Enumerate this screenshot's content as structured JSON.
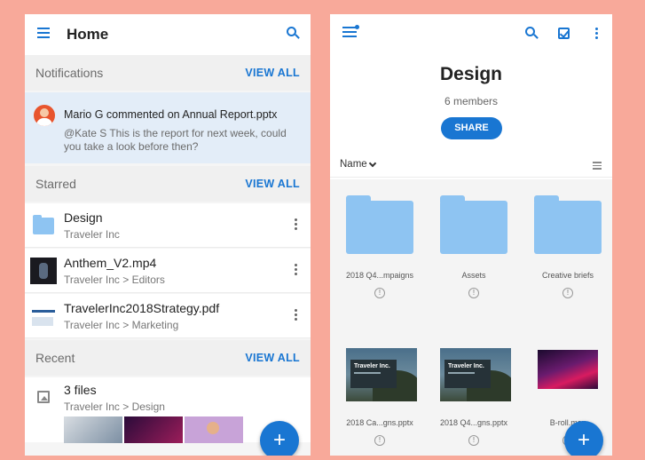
{
  "left": {
    "header": {
      "title": "Home"
    },
    "notifications": {
      "label": "Notifications",
      "view_all": "VIEW ALL",
      "item": {
        "title": "Mario G commented on Annual Report.pptx",
        "body": "@Kate S This is the report for next week, could you take a look before then?"
      }
    },
    "starred": {
      "label": "Starred",
      "view_all": "VIEW ALL",
      "items": [
        {
          "name": "Design",
          "sub": "Traveler Inc",
          "icon": "shared-folder-icon"
        },
        {
          "name": "Anthem_V2.mp4",
          "sub": "Traveler Inc > Editors",
          "icon": "video-thumbnail"
        },
        {
          "name": "TravelerInc2018Strategy.pdf",
          "sub": "Traveler Inc > Marketing",
          "icon": "pdf-thumbnail"
        }
      ]
    },
    "recent": {
      "label": "Recent",
      "view_all": "VIEW ALL",
      "item": {
        "name": "3 files",
        "sub": "Traveler Inc > Design"
      }
    },
    "fab": "+"
  },
  "right": {
    "title": "Design",
    "members": "6 members",
    "share": "SHARE",
    "sort": {
      "label": "Name"
    },
    "folders": [
      {
        "name": "2018 Q4...mpaigns"
      },
      {
        "name": "Assets"
      },
      {
        "name": "Creative briefs"
      }
    ],
    "files": [
      {
        "name": "2018 Ca...gns.pptx",
        "slide_text": "Traveler Inc."
      },
      {
        "name": "2018 Q4...gns.pptx",
        "slide_text": "Traveler Inc."
      },
      {
        "name": "B-roll.mov"
      }
    ],
    "info": "!",
    "fab": "+"
  },
  "colors": {
    "accent": "#1976d2",
    "background": "#f8a99a",
    "folder": "#8ec4f2"
  }
}
